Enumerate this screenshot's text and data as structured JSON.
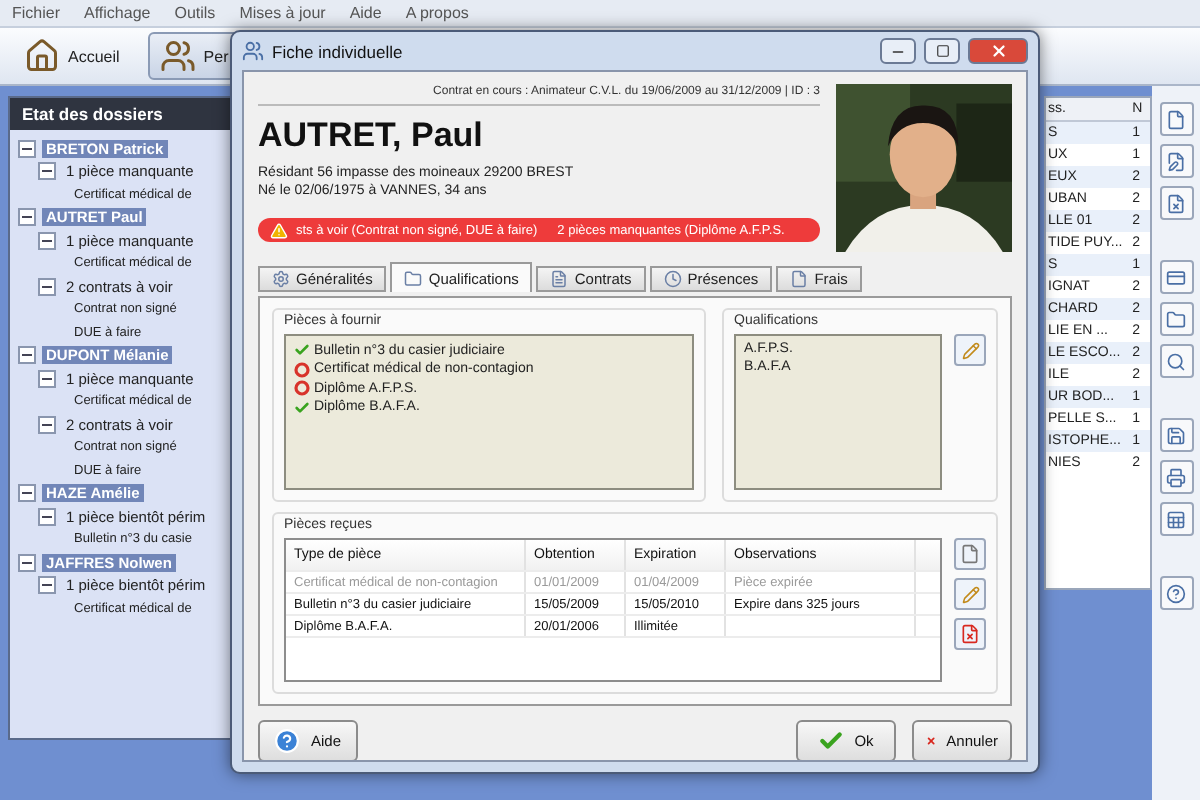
{
  "menu": [
    "Fichier",
    "Affichage",
    "Outils",
    "Mises à jour",
    "Aide",
    "A propos"
  ],
  "toolbar": [
    {
      "label": "Accueil",
      "kind": "home",
      "selected": false
    },
    {
      "label": "Per",
      "kind": "people",
      "selected": true
    }
  ],
  "left_panel": {
    "title": "Etat des dossiers",
    "tree": [
      {
        "label": "BRETON Patrick",
        "expanded": true,
        "children": [
          {
            "label": "1 pièce manquante",
            "expanded": true,
            "children": [
              {
                "label": "Certificat médical de"
              }
            ]
          }
        ]
      },
      {
        "label": "AUTRET Paul",
        "expanded": true,
        "children": [
          {
            "label": "1 pièce manquante",
            "expanded": true,
            "children": [
              {
                "label": "Certificat médical de"
              }
            ]
          },
          {
            "label": "2 contrats à voir",
            "expanded": true,
            "children": [
              {
                "label": "Contrat non signé"
              },
              {
                "label": "DUE à faire"
              }
            ]
          }
        ]
      },
      {
        "label": "DUPONT Mélanie",
        "expanded": true,
        "children": [
          {
            "label": "1 pièce manquante",
            "expanded": true,
            "children": [
              {
                "label": "Certificat médical de"
              }
            ]
          },
          {
            "label": "2 contrats à voir",
            "expanded": true,
            "children": [
              {
                "label": "Contrat non signé"
              },
              {
                "label": "DUE à faire"
              }
            ]
          }
        ]
      },
      {
        "label": "HAZE Amélie",
        "expanded": true,
        "children": [
          {
            "label": "1 pièce bientôt périm",
            "expanded": true,
            "children": [
              {
                "label": "Bulletin n°3 du casie"
              }
            ]
          }
        ]
      },
      {
        "label": "JAFFRES Nolwen",
        "expanded": true,
        "children": [
          {
            "label": "1 pièce bientôt périm",
            "expanded": true,
            "children": [
              {
                "label": "Certificat médical de"
              }
            ]
          }
        ]
      }
    ]
  },
  "right_list": {
    "columns": [
      "ss.",
      "N"
    ],
    "rows": [
      [
        "S",
        "1"
      ],
      [
        "UX",
        "1"
      ],
      [
        "EUX",
        "2"
      ],
      [
        "UBAN",
        "2"
      ],
      [
        "LLE 01",
        "2"
      ],
      [
        "TIDE PUY...",
        "2"
      ],
      [
        "S",
        "1"
      ],
      [
        "IGNAT",
        "2"
      ],
      [
        "CHARD",
        "2"
      ],
      [
        "LIE EN ...",
        "2"
      ],
      [
        "LE ESCO...",
        "2"
      ],
      [
        "ILE",
        "2"
      ],
      [
        "UR BOD...",
        "1"
      ],
      [
        "PELLE S...",
        "1"
      ],
      [
        "ISTOPHE...",
        "1"
      ],
      [
        "NIES",
        "2"
      ]
    ]
  },
  "right_tools": [
    {
      "kind": "new"
    },
    {
      "kind": "edit"
    },
    {
      "kind": "delete"
    },
    {
      "kind": "gap"
    },
    {
      "kind": "card"
    },
    {
      "kind": "folder"
    },
    {
      "kind": "search"
    },
    {
      "kind": "gap"
    },
    {
      "kind": "save"
    },
    {
      "kind": "print"
    },
    {
      "kind": "excel"
    },
    {
      "kind": "gap"
    },
    {
      "kind": "help"
    }
  ],
  "dialog": {
    "title": "Fiche individuelle",
    "contract": "Contrat en cours : Animateur C.V.L. du 19/06/2009 au 31/12/2009 | ID : 3",
    "name": "AUTRET, Paul",
    "address": "Résidant 56 impasse des moineaux 29200 BREST",
    "birth": "Né le 02/06/1975 à VANNES, 34 ans",
    "alerts": [
      "sts à voir (Contrat non signé, DUE à faire)",
      "2 pièces manquantes (Diplôme A.F.P.S."
    ],
    "tabs": [
      {
        "label": "Généralités",
        "kind": "general",
        "selected": false
      },
      {
        "label": "Qualifications",
        "kind": "qualif",
        "selected": true
      },
      {
        "label": "Contrats",
        "kind": "contracts",
        "selected": false
      },
      {
        "label": "Présences",
        "kind": "presence",
        "selected": false
      },
      {
        "label": "Frais",
        "kind": "fees",
        "selected": false
      }
    ],
    "pieces_a_fournir": {
      "title": "Pièces à fournir",
      "items": [
        {
          "label": "Bulletin n°3 du casier judiciaire",
          "provided": true
        },
        {
          "label": "Certificat médical de non-contagion",
          "provided": false
        },
        {
          "label": "Diplôme A.F.P.S.",
          "provided": false
        },
        {
          "label": "Diplôme B.A.F.A.",
          "provided": true
        }
      ]
    },
    "qualifications": {
      "title": "Qualifications",
      "items": [
        "A.F.P.S.",
        "B.A.F.A"
      ]
    },
    "pieces_recues": {
      "title": "Pièces reçues",
      "columns": [
        "Type de pièce",
        "Obtention",
        "Expiration",
        "Observations"
      ],
      "rows": [
        {
          "cells": [
            "Certificat médical de non-contagion",
            "01/01/2009",
            "01/04/2009",
            "Pièce expirée"
          ],
          "expired": true
        },
        {
          "cells": [
            "Bulletin n°3 du casier judiciaire",
            "15/05/2009",
            "15/05/2010",
            "Expire dans 325 jours"
          ],
          "expired": false
        },
        {
          "cells": [
            "Diplôme B.A.F.A.",
            "20/01/2006",
            "Illimitée"
          ],
          "expired": false
        }
      ]
    },
    "buttons": [
      {
        "label": "Aide",
        "kind": "help"
      },
      {
        "label": "Ok",
        "kind": "ok"
      },
      {
        "label": "Annuler",
        "kind": "cancel"
      }
    ]
  }
}
